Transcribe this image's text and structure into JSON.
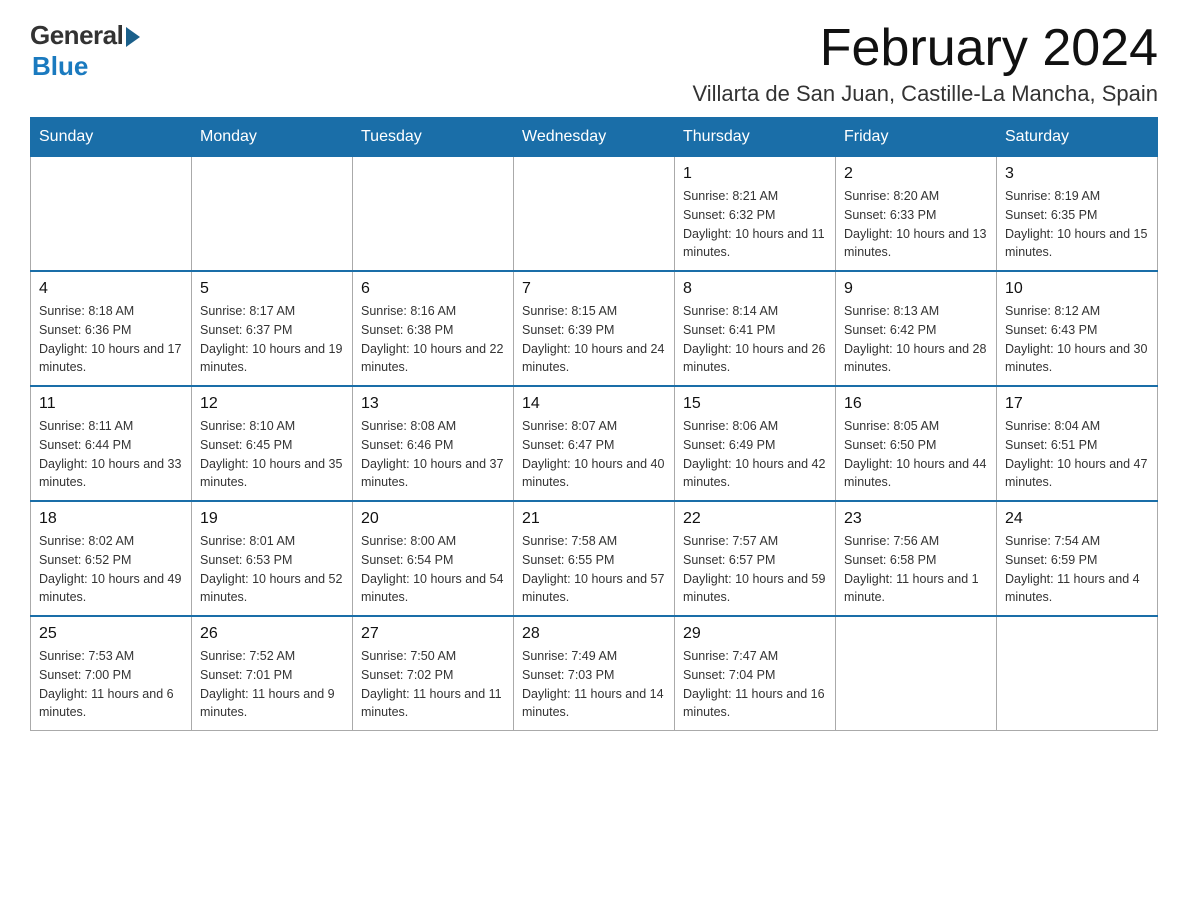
{
  "logo": {
    "general": "General",
    "blue": "Blue"
  },
  "header": {
    "title": "February 2024",
    "subtitle": "Villarta de San Juan, Castille-La Mancha, Spain"
  },
  "days_of_week": [
    "Sunday",
    "Monday",
    "Tuesday",
    "Wednesday",
    "Thursday",
    "Friday",
    "Saturday"
  ],
  "weeks": [
    [
      {
        "day": "",
        "info": ""
      },
      {
        "day": "",
        "info": ""
      },
      {
        "day": "",
        "info": ""
      },
      {
        "day": "",
        "info": ""
      },
      {
        "day": "1",
        "info": "Sunrise: 8:21 AM\nSunset: 6:32 PM\nDaylight: 10 hours and 11 minutes."
      },
      {
        "day": "2",
        "info": "Sunrise: 8:20 AM\nSunset: 6:33 PM\nDaylight: 10 hours and 13 minutes."
      },
      {
        "day": "3",
        "info": "Sunrise: 8:19 AM\nSunset: 6:35 PM\nDaylight: 10 hours and 15 minutes."
      }
    ],
    [
      {
        "day": "4",
        "info": "Sunrise: 8:18 AM\nSunset: 6:36 PM\nDaylight: 10 hours and 17 minutes."
      },
      {
        "day": "5",
        "info": "Sunrise: 8:17 AM\nSunset: 6:37 PM\nDaylight: 10 hours and 19 minutes."
      },
      {
        "day": "6",
        "info": "Sunrise: 8:16 AM\nSunset: 6:38 PM\nDaylight: 10 hours and 22 minutes."
      },
      {
        "day": "7",
        "info": "Sunrise: 8:15 AM\nSunset: 6:39 PM\nDaylight: 10 hours and 24 minutes."
      },
      {
        "day": "8",
        "info": "Sunrise: 8:14 AM\nSunset: 6:41 PM\nDaylight: 10 hours and 26 minutes."
      },
      {
        "day": "9",
        "info": "Sunrise: 8:13 AM\nSunset: 6:42 PM\nDaylight: 10 hours and 28 minutes."
      },
      {
        "day": "10",
        "info": "Sunrise: 8:12 AM\nSunset: 6:43 PM\nDaylight: 10 hours and 30 minutes."
      }
    ],
    [
      {
        "day": "11",
        "info": "Sunrise: 8:11 AM\nSunset: 6:44 PM\nDaylight: 10 hours and 33 minutes."
      },
      {
        "day": "12",
        "info": "Sunrise: 8:10 AM\nSunset: 6:45 PM\nDaylight: 10 hours and 35 minutes."
      },
      {
        "day": "13",
        "info": "Sunrise: 8:08 AM\nSunset: 6:46 PM\nDaylight: 10 hours and 37 minutes."
      },
      {
        "day": "14",
        "info": "Sunrise: 8:07 AM\nSunset: 6:47 PM\nDaylight: 10 hours and 40 minutes."
      },
      {
        "day": "15",
        "info": "Sunrise: 8:06 AM\nSunset: 6:49 PM\nDaylight: 10 hours and 42 minutes."
      },
      {
        "day": "16",
        "info": "Sunrise: 8:05 AM\nSunset: 6:50 PM\nDaylight: 10 hours and 44 minutes."
      },
      {
        "day": "17",
        "info": "Sunrise: 8:04 AM\nSunset: 6:51 PM\nDaylight: 10 hours and 47 minutes."
      }
    ],
    [
      {
        "day": "18",
        "info": "Sunrise: 8:02 AM\nSunset: 6:52 PM\nDaylight: 10 hours and 49 minutes."
      },
      {
        "day": "19",
        "info": "Sunrise: 8:01 AM\nSunset: 6:53 PM\nDaylight: 10 hours and 52 minutes."
      },
      {
        "day": "20",
        "info": "Sunrise: 8:00 AM\nSunset: 6:54 PM\nDaylight: 10 hours and 54 minutes."
      },
      {
        "day": "21",
        "info": "Sunrise: 7:58 AM\nSunset: 6:55 PM\nDaylight: 10 hours and 57 minutes."
      },
      {
        "day": "22",
        "info": "Sunrise: 7:57 AM\nSunset: 6:57 PM\nDaylight: 10 hours and 59 minutes."
      },
      {
        "day": "23",
        "info": "Sunrise: 7:56 AM\nSunset: 6:58 PM\nDaylight: 11 hours and 1 minute."
      },
      {
        "day": "24",
        "info": "Sunrise: 7:54 AM\nSunset: 6:59 PM\nDaylight: 11 hours and 4 minutes."
      }
    ],
    [
      {
        "day": "25",
        "info": "Sunrise: 7:53 AM\nSunset: 7:00 PM\nDaylight: 11 hours and 6 minutes."
      },
      {
        "day": "26",
        "info": "Sunrise: 7:52 AM\nSunset: 7:01 PM\nDaylight: 11 hours and 9 minutes."
      },
      {
        "day": "27",
        "info": "Sunrise: 7:50 AM\nSunset: 7:02 PM\nDaylight: 11 hours and 11 minutes."
      },
      {
        "day": "28",
        "info": "Sunrise: 7:49 AM\nSunset: 7:03 PM\nDaylight: 11 hours and 14 minutes."
      },
      {
        "day": "29",
        "info": "Sunrise: 7:47 AM\nSunset: 7:04 PM\nDaylight: 11 hours and 16 minutes."
      },
      {
        "day": "",
        "info": ""
      },
      {
        "day": "",
        "info": ""
      }
    ]
  ]
}
